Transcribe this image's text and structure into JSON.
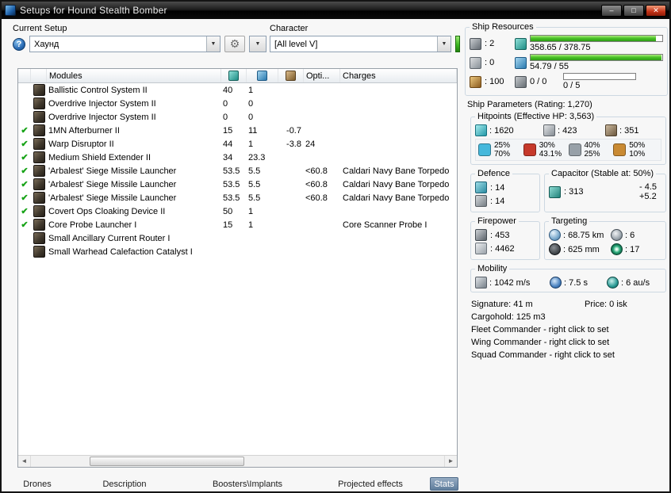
{
  "window": {
    "title": "Setups for Hound Stealth Bomber",
    "controls": {
      "minimize": "–",
      "maximize": "□",
      "close": "✕"
    }
  },
  "toolbar": {
    "current_setup_label": "Current Setup",
    "setup_value": "Хаунд",
    "character_label": "Character",
    "character_value": "[All level V]",
    "help_glyph": "?",
    "tools_glyph": "⚙",
    "dropdown_glyph": "▼"
  },
  "modules": {
    "headers": {
      "name": "Modules",
      "opti": "Opti...",
      "charges": "Charges"
    },
    "rows": [
      {
        "check": "",
        "name": "Ballistic Control System II",
        "cpu": "40",
        "pg": "1",
        "cap": "",
        "opti": "",
        "charge": ""
      },
      {
        "check": "",
        "name": "Overdrive Injector System II",
        "cpu": "0",
        "pg": "0",
        "cap": "",
        "opti": "",
        "charge": ""
      },
      {
        "check": "",
        "name": "Overdrive Injector System II",
        "cpu": "0",
        "pg": "0",
        "cap": "",
        "opti": "",
        "charge": ""
      },
      {
        "check": "✔",
        "name": "1MN Afterburner II",
        "cpu": "15",
        "pg": "11",
        "cap": "-0.7",
        "opti": "",
        "charge": ""
      },
      {
        "check": "✔",
        "name": "Warp Disruptor II",
        "cpu": "44",
        "pg": "1",
        "cap": "-3.8",
        "opti": "24",
        "charge": ""
      },
      {
        "check": "✔",
        "name": "Medium Shield Extender II",
        "cpu": "34",
        "pg": "23.3",
        "cap": "",
        "opti": "",
        "charge": ""
      },
      {
        "check": "✔",
        "name": "'Arbalest' Siege Missile Launcher",
        "cpu": "53.5",
        "pg": "5.5",
        "cap": "",
        "opti": "<60.8",
        "charge": "Caldari Navy Bane Torpedo"
      },
      {
        "check": "✔",
        "name": "'Arbalest' Siege Missile Launcher",
        "cpu": "53.5",
        "pg": "5.5",
        "cap": "",
        "opti": "<60.8",
        "charge": "Caldari Navy Bane Torpedo"
      },
      {
        "check": "✔",
        "name": "'Arbalest' Siege Missile Launcher",
        "cpu": "53.5",
        "pg": "5.5",
        "cap": "",
        "opti": "<60.8",
        "charge": "Caldari Navy Bane Torpedo"
      },
      {
        "check": "✔",
        "name": "Covert Ops Cloaking Device II",
        "cpu": "50",
        "pg": "1",
        "cap": "",
        "opti": "",
        "charge": ""
      },
      {
        "check": "✔",
        "name": "Core Probe Launcher I",
        "cpu": "15",
        "pg": "1",
        "cap": "",
        "opti": "",
        "charge": "Core Scanner Probe I"
      },
      {
        "check": "",
        "name": "Small Ancillary Current Router I",
        "cpu": "",
        "pg": "",
        "cap": "",
        "opti": "",
        "charge": ""
      },
      {
        "check": "",
        "name": "Small Warhead Calefaction Catalyst I",
        "cpu": "",
        "pg": "",
        "cap": "",
        "opti": "",
        "charge": ""
      }
    ]
  },
  "scrollbar": {
    "left": "◄",
    "right": "►"
  },
  "tabs": [
    {
      "label": "Drones",
      "active": false
    },
    {
      "label": "Description",
      "active": false
    },
    {
      "label": "Boosters\\Implants",
      "active": false
    },
    {
      "label": "Projected effects",
      "active": false
    },
    {
      "label": "Stats",
      "active": true
    }
  ],
  "resources": {
    "title": "Ship Resources",
    "turret_slots": ": 2",
    "launcher_slots": ": 0",
    "calibration": ": 100",
    "cpu_text": "358.65 / 378.75",
    "powergrid_text": "54.79 / 55",
    "drone_bay": "0 / 0",
    "drone_bandwidth": "0 / 5"
  },
  "parameters": {
    "title": "Ship Parameters (Rating: 1,270)",
    "hitpoints": {
      "title": "Hitpoints (Effective HP: 3,563)",
      "shield": ": 1620",
      "armor": ": 423",
      "structure": ": 351",
      "resists": [
        {
          "label": "em",
          "top": "25%",
          "bottom": "70%",
          "color": "#45b8dc"
        },
        {
          "label": "thermal",
          "top": "30%",
          "bottom": "43.1%",
          "color": "#c6392b"
        },
        {
          "label": "kinetic",
          "top": "40%",
          "bottom": "25%",
          "color": "#97a0a8"
        },
        {
          "label": "explosive",
          "top": "50%",
          "bottom": "10%",
          "color": "#c98a33"
        }
      ]
    },
    "defence": {
      "title": "Defence",
      "value1": ": 14",
      "value2": ": 14"
    },
    "capacitor": {
      "title": "Capacitor (Stable at: 50%)",
      "amount": ": 313",
      "drain": "- 4.5",
      "recharge": "+5.2"
    },
    "firepower": {
      "title": "Firepower",
      "value1": ": 453",
      "value2": ": 4462"
    },
    "targeting": {
      "title": "Targeting",
      "range": ": 68.75 km",
      "max_targets": ": 6",
      "scan_resolution": ": 625 mm",
      "sensor_strength": ": 17"
    },
    "mobility": {
      "title": "Mobility",
      "speed": ": 1042 m/s",
      "align_time": ": 7.5 s",
      "warp_speed": ": 6 au/s"
    }
  },
  "info": {
    "signature": "Signature: 41 m",
    "price": "Price: 0 isk",
    "cargohold": "Cargohold: 125 m3",
    "fleet": "Fleet Commander - right click to set",
    "wing": "Wing Commander - right click to set",
    "squad": "Squad Commander - right click to set"
  },
  "colors": {
    "bar_green": "#3fb51f",
    "check_green": "#17a317",
    "tab_active": "#6e88a6"
  }
}
